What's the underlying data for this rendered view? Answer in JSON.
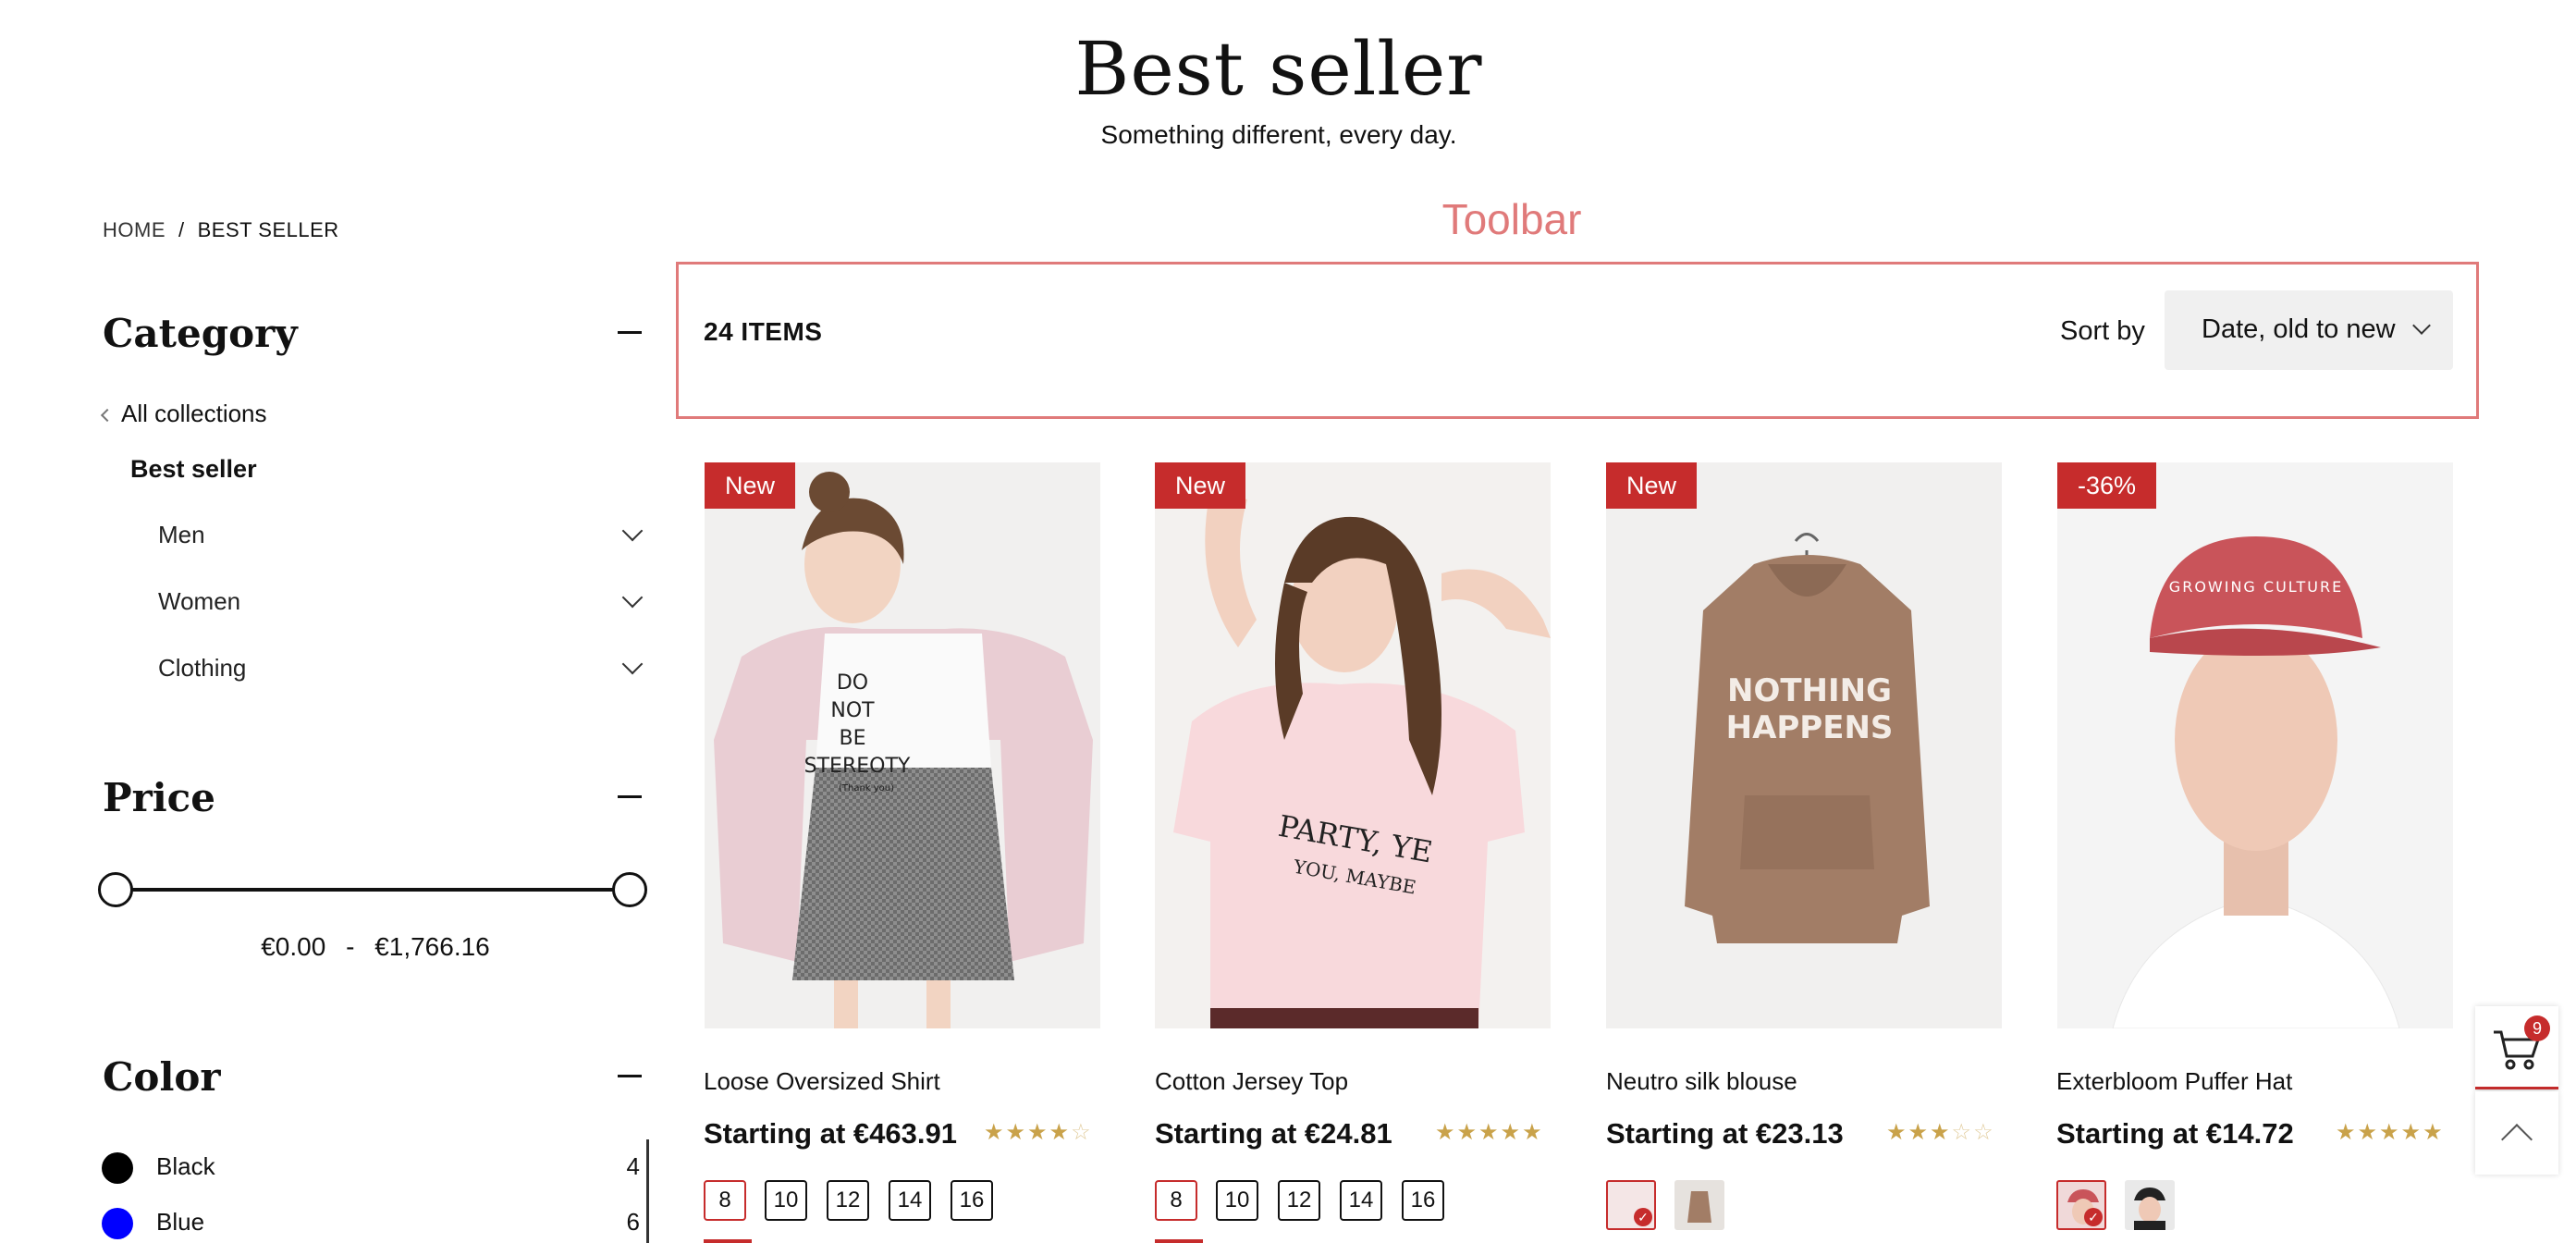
{
  "hero": {
    "title": "Best seller",
    "subtitle": "Something different, every day."
  },
  "breadcrumb": {
    "home": "HOME",
    "separator": "/",
    "current": "BEST SELLER"
  },
  "sidebar": {
    "category": {
      "title": "Category",
      "all_collections": "All collections",
      "current": "Best seller",
      "items": [
        {
          "label": "Men"
        },
        {
          "label": "Women"
        },
        {
          "label": "Clothing"
        }
      ]
    },
    "price": {
      "title": "Price",
      "min": "€0.00",
      "separator": "-",
      "max": "€1,766.16"
    },
    "color": {
      "title": "Color",
      "items": [
        {
          "label": "Black",
          "count": "4",
          "swatch": "#000000"
        },
        {
          "label": "Blue",
          "count": "6",
          "swatch": "#0000ff"
        }
      ]
    }
  },
  "toolbar": {
    "annotation": "Toolbar",
    "items_count": "24 ITEMS",
    "sort_label": "Sort by",
    "sort_value": "Date, old to new"
  },
  "products": [
    {
      "badge": "New",
      "name": "Loose Oversized Shirt",
      "price": "Starting at €463.91",
      "rating": 4,
      "sizes": [
        "8",
        "10",
        "12",
        "14",
        "16"
      ]
    },
    {
      "badge": "New",
      "name": "Cotton Jersey Top",
      "price": "Starting at €24.81",
      "rating": 5,
      "sizes": [
        "8",
        "10",
        "12",
        "14",
        "16"
      ]
    },
    {
      "badge": "New",
      "name": "Neutro silk blouse",
      "price": "Starting at €23.13",
      "rating": 3
    },
    {
      "badge": "-36%",
      "name": "Exterbloom Puffer Hat",
      "price": "Starting at €14.72",
      "rating": 5
    }
  ],
  "product_images": {
    "p1_shirt_text": [
      "DO",
      "NOT",
      "BE",
      "STEREOTY",
      "(Thank you)"
    ],
    "p2_shirt_text": [
      "PARTY, YE",
      "YOU, MAYBE"
    ],
    "p3_hoodie_text": [
      "NOTHING",
      "HAPPENS"
    ],
    "p4_cap_text": "GROWING CULTURE"
  },
  "cart": {
    "count": "9"
  },
  "colors": {
    "accent": "#c62c2c",
    "toolbar_outline": "#e07a7a",
    "star": "#c9a24a"
  },
  "icons": {
    "cart": "cart-icon",
    "back_to_top": "chevron-up-icon"
  }
}
